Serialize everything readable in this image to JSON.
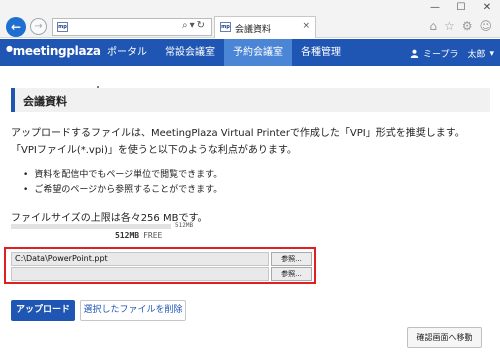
{
  "browser": {
    "window_controls": [
      "—",
      "☐",
      "✕"
    ],
    "address_favicon": "mp",
    "tab_title": "会議資料",
    "tab_close": "×",
    "toolbar_icons": [
      "⌂",
      "☆",
      "⚙",
      "☺"
    ]
  },
  "navbar": {
    "logo": "meetingplaza",
    "items": [
      {
        "label": "ポータル",
        "active": false
      },
      {
        "label": "常設会議室",
        "active": false
      },
      {
        "label": "予約会議室",
        "active": true
      },
      {
        "label": "各種管理",
        "active": false
      }
    ],
    "user_name": "ミープラ　太郎",
    "user_caret": "▾"
  },
  "page": {
    "title": "会議資料",
    "description_lines": [
      "アップロードするファイルは、MeetingPlaza Virtual Printerで作成した「VPI」形式を推奨します。",
      "「VPIファイル(*.vpi)」を使うと以下のような利点があります。"
    ],
    "benefits": [
      "資料を配信中でもページ単位で閲覧できます。",
      "ご希望のページから参照することができます。"
    ],
    "size_limit": "ファイルサイズの上限は各々256 MBです。",
    "quota_max": "512MB",
    "quota_used_fraction": 0,
    "quota_free_value": "512MB",
    "quota_free_label": "FREE"
  },
  "files": [
    {
      "value": "C:\\Data\\PowerPoint.ppt",
      "browse_label": "参照..."
    },
    {
      "value": "",
      "browse_label": "参照..."
    }
  ],
  "buttons": {
    "upload": "アップロード",
    "delete_selected": "選択したファイルを削除",
    "confirm": "確認画面へ移動"
  },
  "colors": {
    "brand": "#1f56b3",
    "nav_active": "#4b85d6",
    "highlight_border": "#e02020"
  }
}
